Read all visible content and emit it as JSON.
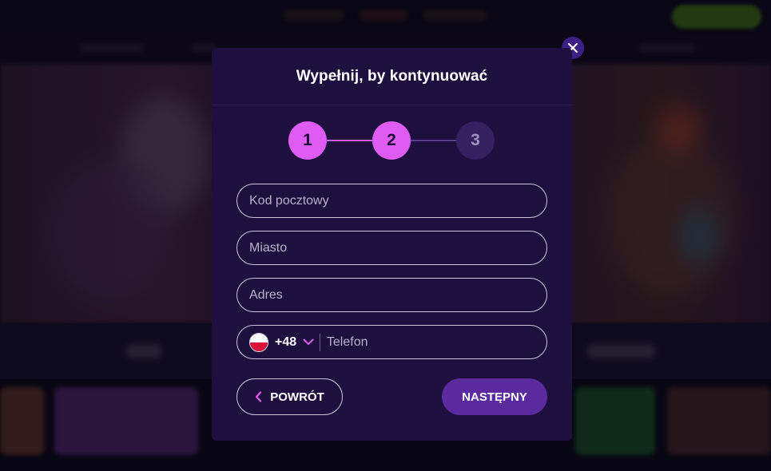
{
  "modal": {
    "title": "Wypełnij, by kontynuować",
    "close_icon": "close-icon"
  },
  "stepper": {
    "steps": [
      {
        "label": "1",
        "state": "done"
      },
      {
        "label": "2",
        "state": "current"
      },
      {
        "label": "3",
        "state": "pending"
      }
    ],
    "active_color": "#df5cf2",
    "pending_color": "#35215f"
  },
  "form": {
    "postal_code": {
      "placeholder": "Kod pocztowy",
      "value": ""
    },
    "city": {
      "placeholder": "Miasto",
      "value": ""
    },
    "address": {
      "placeholder": "Adres",
      "value": ""
    },
    "phone": {
      "country_flag": "poland-flag-icon",
      "dial_code": "+48",
      "placeholder": "Telefon",
      "value": ""
    }
  },
  "actions": {
    "back_label": "POWRÓT",
    "next_label": "NASTĘPNY"
  },
  "colors": {
    "modal_bg": "#1f0f3e",
    "accent": "#df5cf2",
    "primary_button": "#5a2a9e"
  }
}
